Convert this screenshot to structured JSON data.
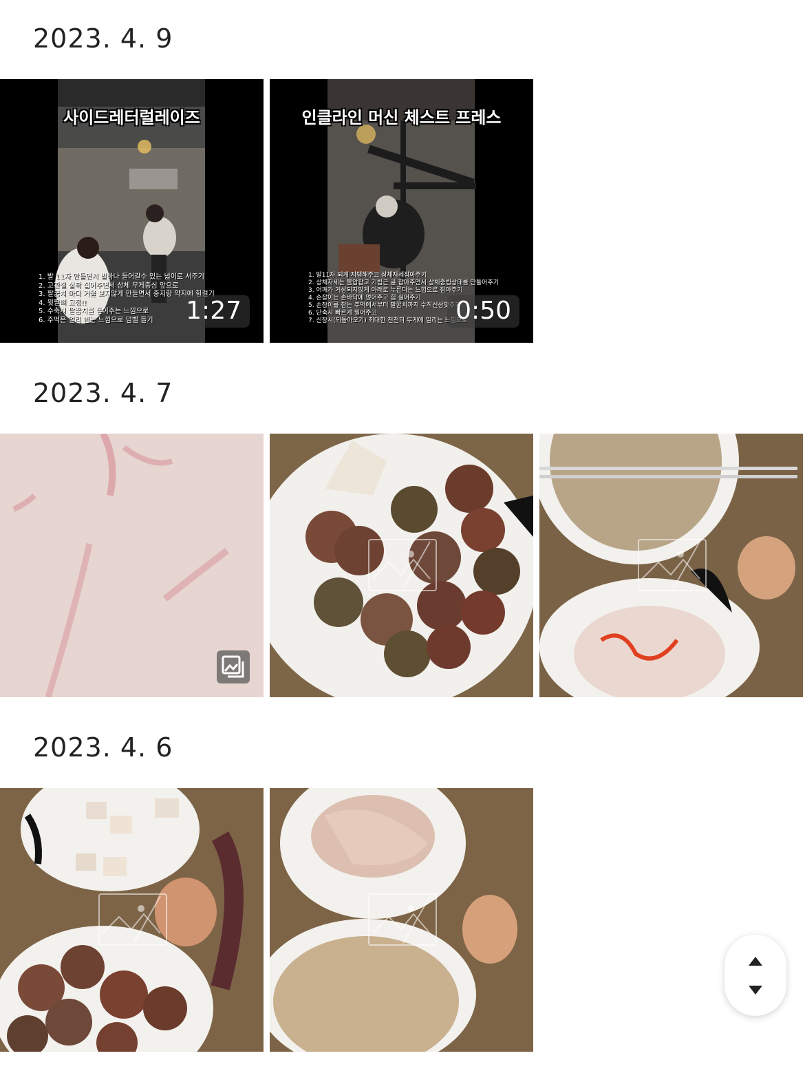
{
  "sections": [
    {
      "date": "2023. 4. 9",
      "items": [
        {
          "kind": "video",
          "duration": "1:27",
          "title": "사이드레터럴레이즈",
          "caption_lines": [
            "1. 발 11자 만들면서 발하나 들어갈수 있는 넓이로 서주기",
            "2. 고관절 살짝 접어주면서 상체 무게중심 앞으로",
            "3. 팔꿈치 마디 거울 보지않게 만들면서 중지랑 약지에 힘걸기",
            "4. 윗팔뼈 고정!!",
            "5. 수축시 팔꿈치를 들어주는 느낌으로",
            "6. 주먹은 멀리 뻗는 느낌으로 덤벨 들기"
          ]
        },
        {
          "kind": "video",
          "duration": "0:50",
          "title": "인클라인 머신 체스트 프레스",
          "caption_lines": [
            "1. 발11자 되게 지탱해주고 상체자세잡아주기",
            "2. 상체자세는 볼압잡고 기립근 골 잡아주면서 상체중립상태를 만들어주기",
            "3. 어깨가 거상되지않게 아래로 누른다는 느낌으로 잡아주기",
            "4. 손잡이는 손바닥에 얹어주고 힘 실어주기",
            "5. 손잡이를 잡는 주먹에서부터 팔꿈치까지 수직선상맞추기",
            "6. 단축시 빠르게 밀어주고",
            "7. 신장시(되돌아오기) 최대한 천천히 무게에 밀리는 느낌으로"
          ]
        }
      ]
    },
    {
      "date": "2023. 4. 7",
      "items": [
        {
          "kind": "photo-multi"
        },
        {
          "kind": "photo"
        },
        {
          "kind": "photo"
        }
      ]
    },
    {
      "date": "2023. 4. 6",
      "items": [
        {
          "kind": "photo"
        },
        {
          "kind": "photo"
        }
      ]
    }
  ],
  "icons": {
    "multi_photo": "multiple-photos-icon",
    "placeholder": "image-placeholder-icon",
    "scroll_up": "arrow-up-icon",
    "scroll_down": "arrow-down-icon"
  }
}
